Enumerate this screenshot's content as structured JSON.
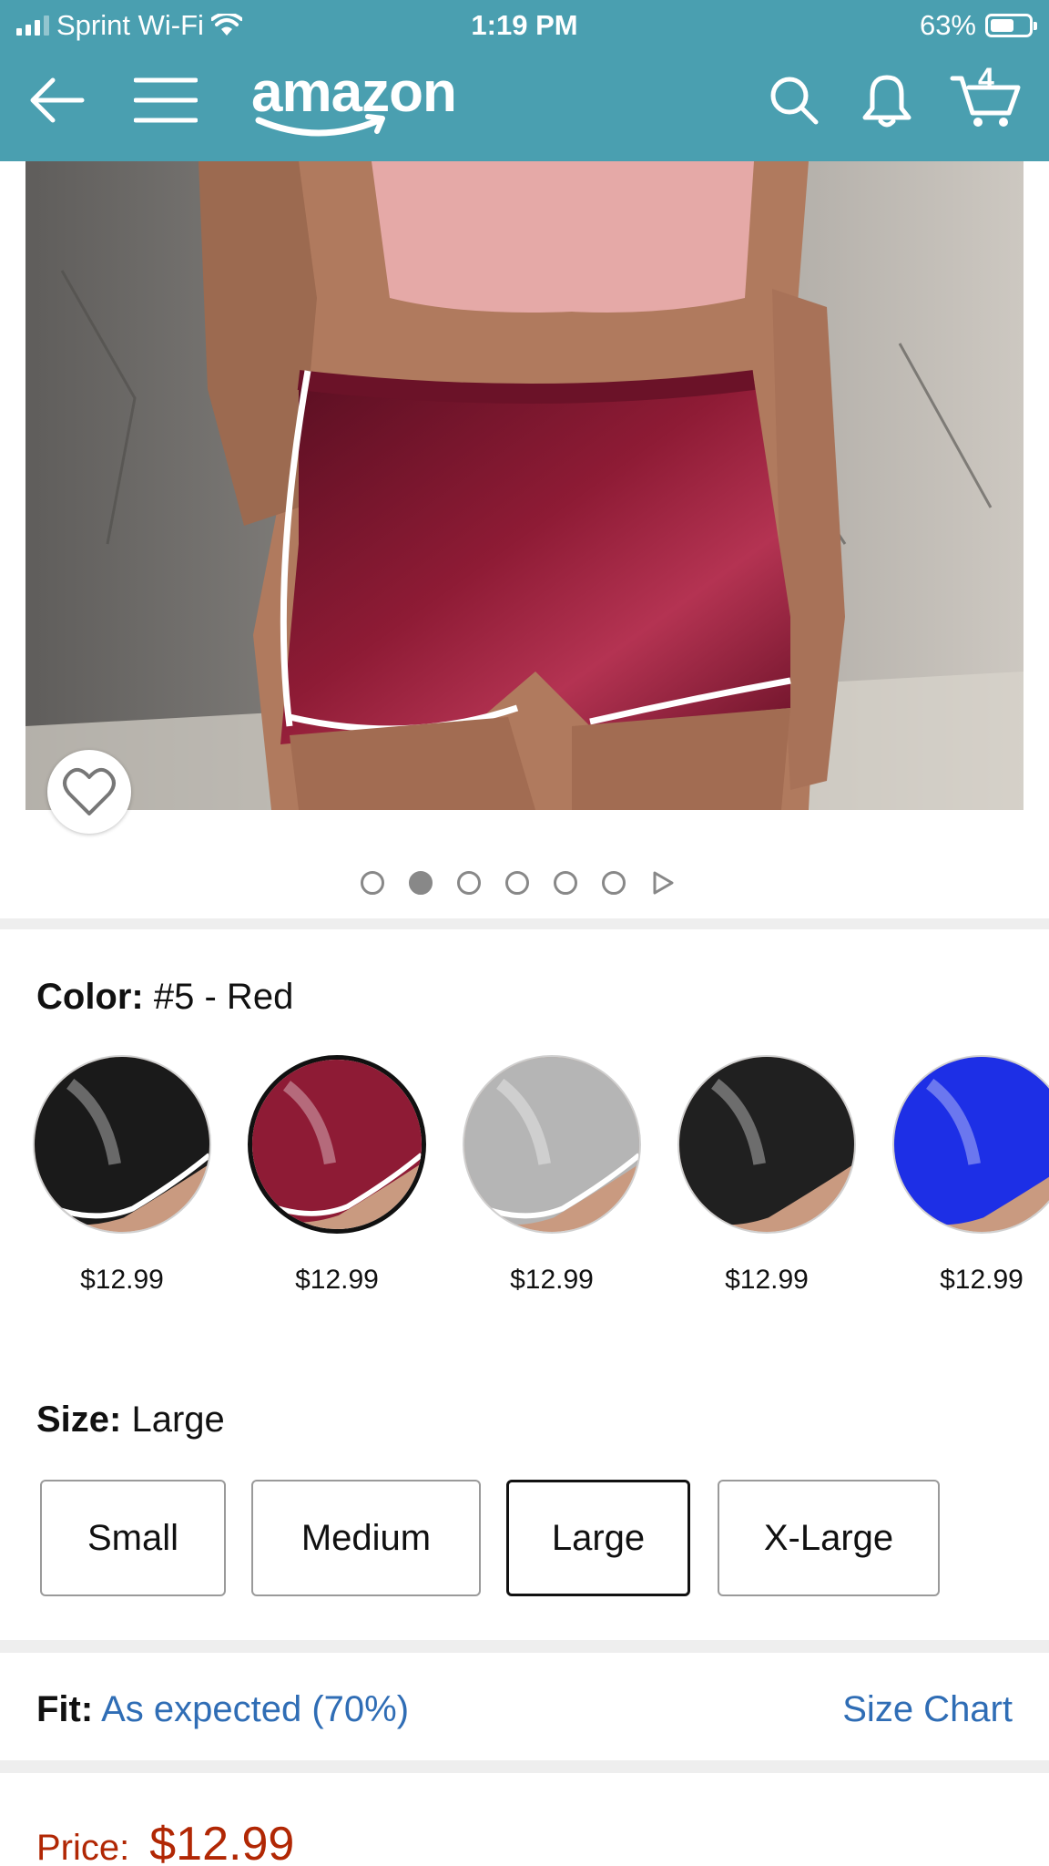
{
  "status_bar": {
    "carrier": "Sprint Wi-Fi",
    "time": "1:19 PM",
    "battery": "63%",
    "battery_level": 0.63
  },
  "navbar": {
    "logo": "amazon",
    "cart_count": "4",
    "icons": [
      "back-arrow-icon",
      "menu-icon",
      "search-icon",
      "bell-icon",
      "cart-icon"
    ]
  },
  "gallery": {
    "image_count": 6,
    "active_index": 1,
    "next_icon": "play-icon"
  },
  "color": {
    "label": "Color:",
    "value": "#5 - Red",
    "swatches": [
      {
        "name": "black-satin",
        "price": "$12.99",
        "color": "#1a1a1a",
        "selected": false
      },
      {
        "name": "red-satin",
        "price": "$12.99",
        "color": "#8e1b35",
        "selected": true
      },
      {
        "name": "silver-satin",
        "price": "$12.99",
        "color": "#b5b5b5",
        "selected": false
      },
      {
        "name": "black-leggings",
        "price": "$12.99",
        "color": "#202020",
        "selected": false
      },
      {
        "name": "blue-leggings",
        "price": "$12.99",
        "color": "#1d2fe6",
        "selected": false
      }
    ]
  },
  "size": {
    "label": "Size:",
    "value": "Large",
    "options": [
      "Small",
      "Medium",
      "Large",
      "X-Large"
    ],
    "selected": "Large"
  },
  "fit": {
    "label": "Fit:",
    "value": "As expected (70%)",
    "size_chart": "Size Chart"
  },
  "price": {
    "label": "Price:",
    "value": "$12.99"
  },
  "colors": {
    "header": "#4a9fb0",
    "link": "#2f6db5",
    "price": "#b12704"
  }
}
